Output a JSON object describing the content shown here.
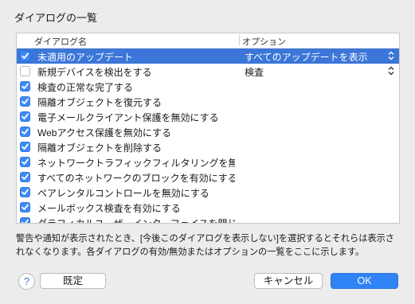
{
  "dialog": {
    "title": "ダイアログの一覧"
  },
  "table": {
    "col_name": "ダイアログ名",
    "col_option": "オプション",
    "rows": [
      {
        "label": "未適用のアップデート",
        "checked": true,
        "selected": true,
        "option": "すべてのアップデートを表示"
      },
      {
        "label": "新規デバイスを検出をする",
        "checked": false,
        "selected": false,
        "option": "検査"
      },
      {
        "label": "検査の正常な完了する",
        "checked": true,
        "selected": false,
        "option": ""
      },
      {
        "label": "隔離オブジェクトを復元する",
        "checked": true,
        "selected": false,
        "option": ""
      },
      {
        "label": "電子メールクライアント保護を無効にする",
        "checked": true,
        "selected": false,
        "option": ""
      },
      {
        "label": "Webアクセス保護を無効にする",
        "checked": true,
        "selected": false,
        "option": ""
      },
      {
        "label": "隔離オブジェクトを削除する",
        "checked": true,
        "selected": false,
        "option": ""
      },
      {
        "label": "ネットワークトラフィックフィルタリングを無…",
        "checked": true,
        "selected": false,
        "option": ""
      },
      {
        "label": "すべてのネットワークのブロックを有効にする",
        "checked": true,
        "selected": false,
        "option": ""
      },
      {
        "label": "ペアレンタルコントロールを無効にする",
        "checked": true,
        "selected": false,
        "option": ""
      },
      {
        "label": "メールボックス検査を有効にする",
        "checked": true,
        "selected": false,
        "option": ""
      },
      {
        "label": "グラフィカルユーザーインターフェイスを閉じる",
        "checked": true,
        "selected": false,
        "option": ""
      }
    ]
  },
  "description": "警告や通知が表示されたとき、[今後このダイアログを表示しない]を選択するとそれらは表示されなくなります。各ダイアログの有効/無効またはオプションの一覧をここに示します。",
  "buttons": {
    "help": "?",
    "default": "既定",
    "cancel": "キャンセル",
    "ok": "OK"
  }
}
